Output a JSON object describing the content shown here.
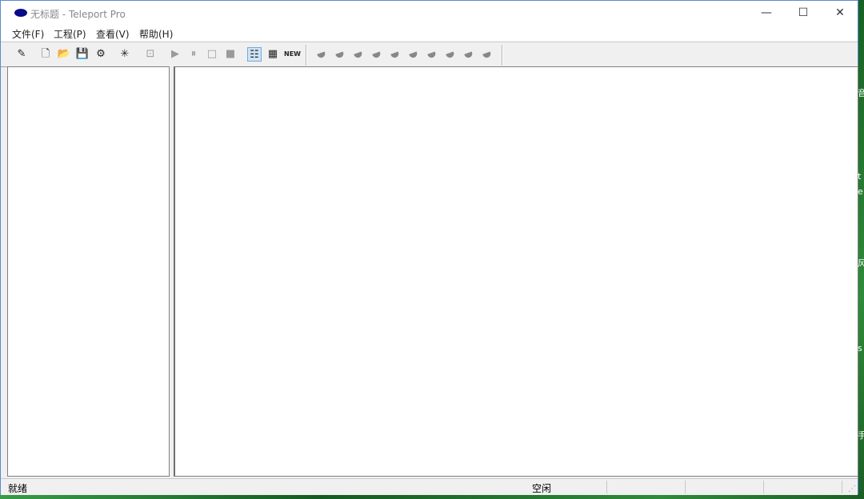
{
  "window": {
    "title": "无标题 - Teleport Pro"
  },
  "title_buttons": {
    "minimize": "—",
    "maximize": "☐",
    "close": "✕"
  },
  "menu": [
    "文件(F)",
    "工程(P)",
    "查看(V)",
    "帮助(H)"
  ],
  "toolbar": {
    "new_wizard": "✎",
    "new": "🗋",
    "open": "📂",
    "save": "💾",
    "properties": "⚙",
    "new_folder": "✳",
    "browse": "⊡",
    "start": "▶",
    "pause": "⏸",
    "stop": "□",
    "halt": "■",
    "tree_view": "☷",
    "list_view": "▦",
    "new_label": "NEW"
  },
  "status": {
    "left": "就绪",
    "center": "空闲"
  },
  "desktop_glyphs": [
    "音",
    "t",
    "e",
    "风",
    "s",
    "手"
  ]
}
